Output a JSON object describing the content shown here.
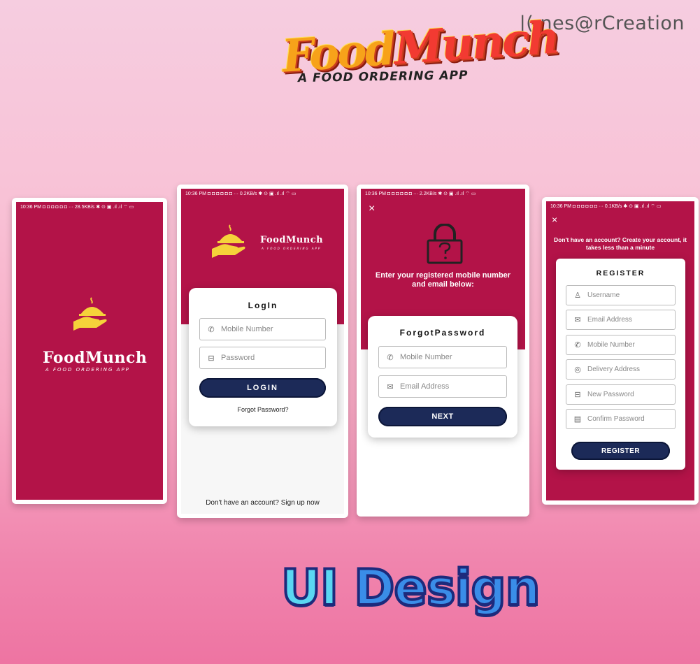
{
  "header": {
    "watermark": "|(.nes@rCreation",
    "brand_title_a": "Food",
    "brand_title_b": "Munch",
    "brand_subtitle": "A food ordering app"
  },
  "footer": {
    "title_a": "UI ",
    "title_b": "Design"
  },
  "colors": {
    "primary": "#b31348",
    "button": "#1c2a58",
    "logo": "#f5d23a"
  },
  "splash": {
    "status": "10:36 PM  ◘ ◘ ◘ ◘ ◘ ◘ ··· 28.5KB/s ✱ ⊙ ▣ .ıl .ıl ⌔ ▭",
    "app_name": "FoodMunch",
    "tagline": "A food ordering app"
  },
  "login": {
    "status": "10:36 PM  ◘ ◘ ◘ ◘ ◘ ◘ ··· 0.2KB/s ✱ ⊙ ▣ .ıl .ıl ⌔ ▭",
    "app_name": "FoodMunch",
    "tagline": "A food ordering app",
    "title": "LogIn",
    "mobile_placeholder": "Mobile Number",
    "password_placeholder": "Password",
    "login_button": "LOGIN",
    "forgot_link": "Forgot Password?",
    "signup_link": "Don't have an account? Sign up now"
  },
  "forgot": {
    "status": "10:36 PM  ◘ ◘ ◘ ◘ ◘ ◘ ··· 2.2KB/s ✱ ⊙ ▣ .ıl .ıl ⌔ ▭",
    "close": "×",
    "instruction": "Enter your registered mobile number and email below:",
    "title": "ForgotPassword",
    "mobile_placeholder": "Mobile Number",
    "email_placeholder": "Email Address",
    "next_button": "NEXT"
  },
  "register": {
    "status": "10:36 PM  ◘ ◘ ◘ ◘ ◘ ◘ ··· 0.1KB/s ✱ ⊙ ▣ .ıl .ıl ⌔ ▭",
    "close": "×",
    "intro": "Don't have an account? Create your account, it takes less than a minute",
    "title": "REGISTER",
    "fields": {
      "username": "Username",
      "email": "Email Address",
      "mobile": "Mobile Number",
      "address": "Delivery Address",
      "new_password": "New Password",
      "confirm_password": "Confirm Password"
    },
    "register_button": "REGISTER"
  }
}
